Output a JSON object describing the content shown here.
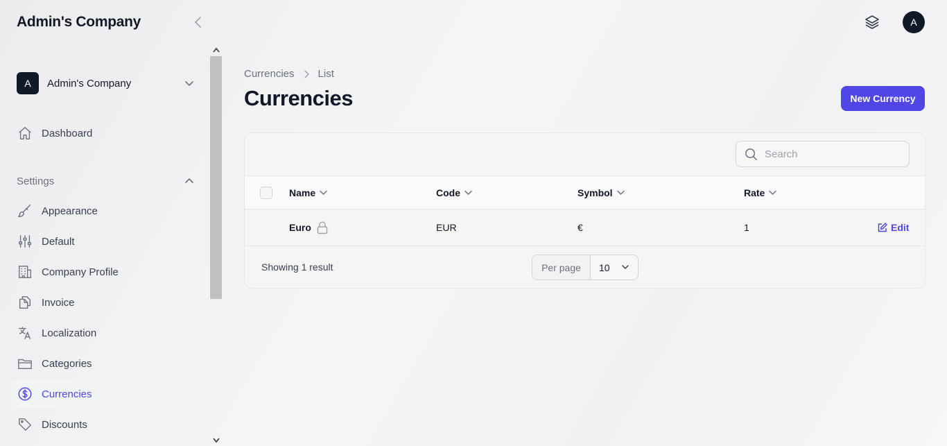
{
  "sidebar": {
    "brand": "Admin's Company",
    "company": {
      "avatar": "A",
      "name": "Admin's Company"
    },
    "dashboard": {
      "label": "Dashboard",
      "icon": "home-icon"
    },
    "settings_group": {
      "label": "Settings"
    },
    "items": [
      {
        "label": "Appearance",
        "icon": "paintbrush-icon"
      },
      {
        "label": "Default",
        "icon": "sliders-icon"
      },
      {
        "label": "Company Profile",
        "icon": "building-icon"
      },
      {
        "label": "Invoice",
        "icon": "document-duplicate-icon"
      },
      {
        "label": "Localization",
        "icon": "language-icon"
      },
      {
        "label": "Categories",
        "icon": "folder-icon"
      },
      {
        "label": "Currencies",
        "icon": "currency-dollar-icon",
        "active": true
      },
      {
        "label": "Discounts",
        "icon": "tag-icon"
      }
    ]
  },
  "topbar": {
    "avatar": "A"
  },
  "breadcrumb": {
    "parent": "Currencies",
    "current": "List"
  },
  "page": {
    "title": "Currencies",
    "new_button": "New Currency"
  },
  "search": {
    "placeholder": "Search",
    "value": ""
  },
  "table": {
    "columns": [
      "Name",
      "Code",
      "Symbol",
      "Rate"
    ],
    "rows": [
      {
        "name": "Euro",
        "code": "EUR",
        "symbol": "€",
        "rate": "1",
        "locked": true,
        "action": "Edit"
      }
    ],
    "footer": {
      "showing": "Showing 1 result",
      "per_page_label": "Per page",
      "per_page_value": "10"
    }
  },
  "colors": {
    "accent": "#4f46e5",
    "dark": "#111827"
  }
}
